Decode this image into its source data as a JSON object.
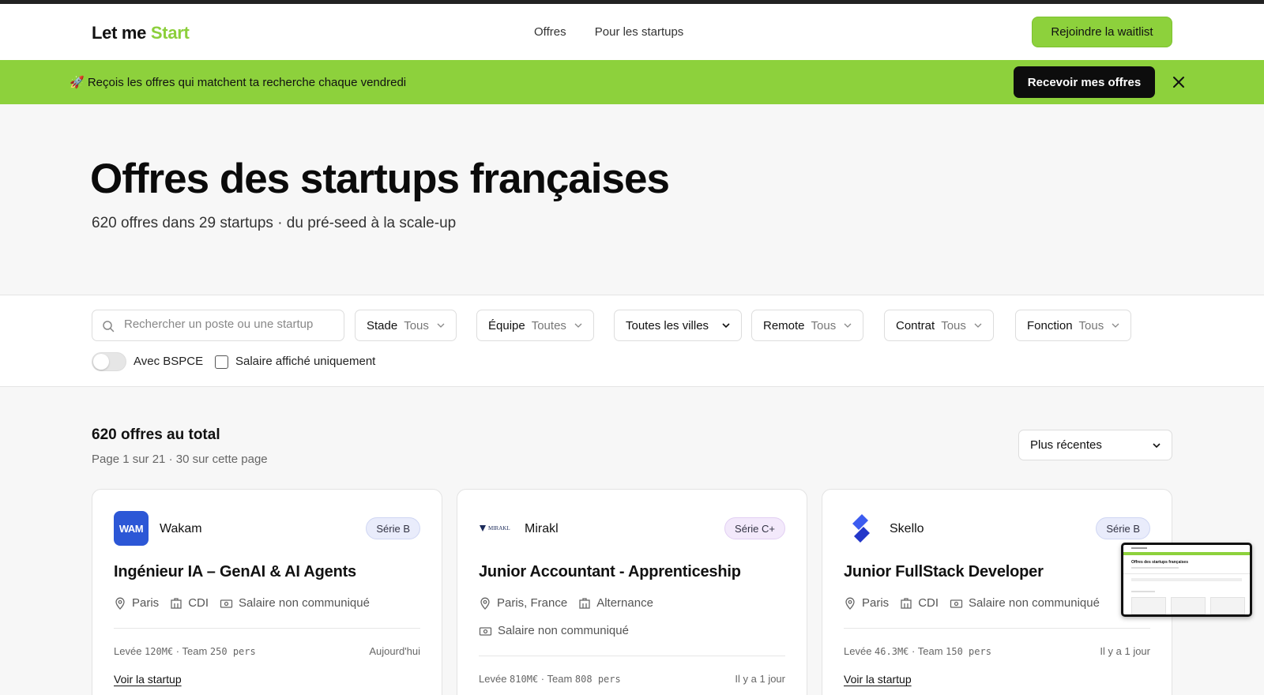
{
  "header": {
    "logo_main": "Let me",
    "logo_accent": "Start",
    "nav": [
      "Offres",
      "Pour les startups"
    ],
    "cta": "Rejoindre la waitlist"
  },
  "banner": {
    "icon": "rocket",
    "text": "🚀 Reçois les offres qui matchent ta recherche chaque vendredi",
    "button": "Recevoir mes offres"
  },
  "hero": {
    "title": "Offres des startups françaises",
    "subtitle": "620 offres dans 29 startups · du pré-seed à la scale-up"
  },
  "filters": {
    "search_placeholder": "Rechercher un poste ou une startup",
    "stade": {
      "label": "Stade",
      "value": "Tous"
    },
    "equipe": {
      "label": "Équipe",
      "value": "Toutes"
    },
    "villes": {
      "label": "Toutes les villes"
    },
    "remote": {
      "label": "Remote",
      "value": "Tous"
    },
    "contrat": {
      "label": "Contrat",
      "value": "Tous"
    },
    "fonction": {
      "label": "Fonction",
      "value": "Tous"
    },
    "bspce_label": "Avec BSPCE",
    "bspce_on": false,
    "salary_label": "Salaire affiché uniquement",
    "salary_checked": false
  },
  "results": {
    "title": "620 offres au total",
    "sub": "Page 1 sur 21 · 30 sur cette page",
    "sort": "Plus récentes"
  },
  "cards": [
    {
      "company": "Wakam",
      "logo_text": "WAM",
      "badge": "Série B",
      "title": "Ingénieur IA – GenAI & AI Agents",
      "location": "Paris",
      "contract": "CDI",
      "salary": "Salaire non communiqué",
      "funding_prefix": "Levée",
      "funding_amount": "120M€",
      "team_prefix": "· Team",
      "team_size": "250 pers",
      "date": "Aujourd'hui",
      "link": "Voir la startup"
    },
    {
      "company": "Mirakl",
      "logo_text": "MIRAKL",
      "badge": "Série C+",
      "title": "Junior Accountant - Apprenticeship",
      "location": "Paris, France",
      "contract": "Alternance",
      "salary": "Salaire non communiqué",
      "funding_prefix": "Levée",
      "funding_amount": "810M€",
      "team_prefix": "· Team",
      "team_size": "808 pers",
      "date": "Il y a 1 jour"
    },
    {
      "company": "Skello",
      "badge": "Série B",
      "title": "Junior FullStack Developer",
      "location": "Paris",
      "contract": "CDI",
      "salary": "Salaire non communiqué",
      "funding_prefix": "Levée",
      "funding_amount": "46.3M€",
      "team_prefix": "· Team",
      "team_size": "150 pers",
      "date": "Il y a 1 jour",
      "link": "Voir la startup"
    }
  ],
  "colors": {
    "accent": "#8dd13c",
    "dark": "#0d0d0d",
    "wakam_blue": "#2c57d6",
    "skello_blue": "#3c5cf0"
  }
}
